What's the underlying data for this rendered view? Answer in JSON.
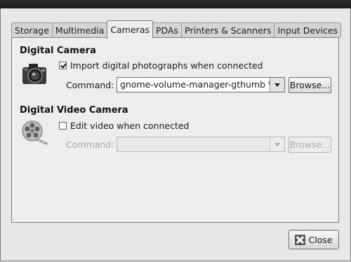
{
  "tabs": [
    {
      "label": "Storage",
      "active": false
    },
    {
      "label": "Multimedia",
      "active": false
    },
    {
      "label": "Cameras",
      "active": true
    },
    {
      "label": "PDAs",
      "active": false
    },
    {
      "label": "Printers & Scanners",
      "active": false
    },
    {
      "label": "Input Devices",
      "active": false
    }
  ],
  "digital_camera": {
    "title": "Digital Camera",
    "icon": "camera-icon",
    "checkbox_label": "Import digital photographs when connected",
    "checked": true,
    "command_label": "Command:",
    "command_value": "gnome-volume-manager-gthumb %h",
    "browse_label": "Browse..."
  },
  "video_camera": {
    "title": "Digital Video Camera",
    "icon": "film-reel-icon",
    "checkbox_label": "Edit video when connected",
    "checked": false,
    "command_label": "Command:",
    "command_value": "",
    "browse_label": "Browse..."
  },
  "footer": {
    "close_label": "Close",
    "close_icon": "close-icon"
  }
}
